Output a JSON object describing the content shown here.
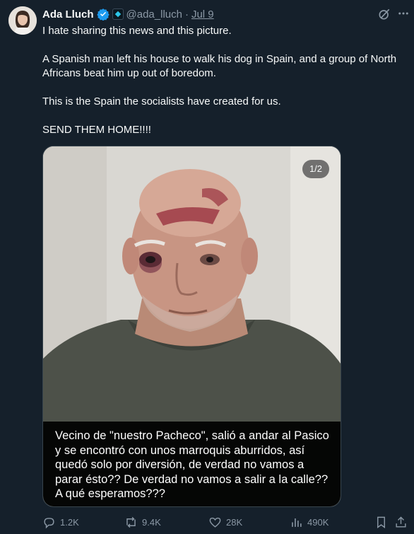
{
  "author": {
    "name": "Ada Lluch",
    "handle": "@ada_lluch",
    "separator": "·",
    "date": "Jul 9"
  },
  "tweet": {
    "paragraphs": [
      "I hate sharing this news and this picture.",
      "A Spanish man left his house to walk his dog in Spain, and a group of North Africans beat him up out of boredom.",
      "This is the Spain the socialists have created for us.",
      "SEND THEM HOME!!!!"
    ]
  },
  "media": {
    "counter": "1/2",
    "caption": "Vecino de \"nuestro Pacheco\", salió a andar al Pasico y se encontró con unos marroquis aburridos, así quedó solo por diversión, de verdad no vamos a parar ésto?? De verdad no vamos a salir a la calle?? A qué esperamos???"
  },
  "actions": {
    "replies": "1.2K",
    "reposts": "9.4K",
    "likes": "28K",
    "views": "490K"
  },
  "icons": {
    "reply": "reply-icon",
    "repost": "repost-icon",
    "like": "heart-icon",
    "views": "views-icon",
    "bookmark": "bookmark-icon",
    "share": "share-icon",
    "grok": "grok-icon",
    "more": "more-icon"
  },
  "colors": {
    "background": "#15202b",
    "verified": "#1d9bf0",
    "muted": "#8b98a5"
  }
}
